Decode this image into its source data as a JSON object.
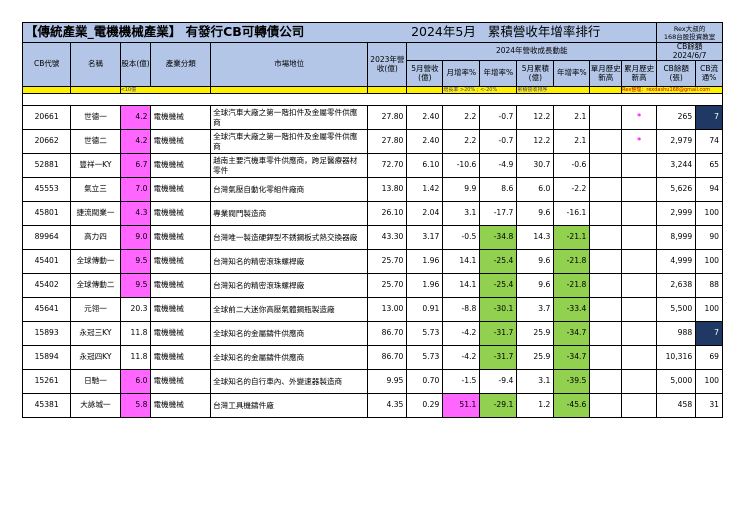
{
  "title": {
    "main": "【傳統產業_電機機械產業】 有發行CB可轉債公司",
    "month": "2024年5月",
    "rank": "累積營收年增率排行",
    "rex_line1": "Rex大叔的",
    "rex_line2": "168台股投資教室"
  },
  "headers": {
    "cb_code": "CB代號",
    "name": "名稱",
    "capital": "股本(億)",
    "industry": "產業分類",
    "position": "市場地位",
    "rev2023": "2023年營收(億)",
    "growth_group": "2024年營收成長動能",
    "may_rev": "5月營收(億)",
    "mom": "月增率%",
    "yoy": "年增率%",
    "may_cum": "5月累積(億)",
    "cum_yoy": "年增率%",
    "month_high": "單月歷史新高",
    "cum_high": "累月歷史新高",
    "cb_balance_group": "CB餘額",
    "cb_date": "2024/6/7",
    "cb_amount": "CB餘額(張)",
    "cb_ratio": "CB流通%"
  },
  "legend": {
    "capital_note": "<10億",
    "growth_note": "增長率 >20% ; <-20%",
    "cum_note": "累積營收排序",
    "rex_contact": "Rex整理：rexdashu168@gmail.com"
  },
  "colors": {
    "header_blue": "#b4c6e7",
    "yellow": "#fff200",
    "pink": "#ff66ff",
    "green": "#92d050",
    "navy": "#1f3864"
  },
  "rows": [
    {
      "code": "20661",
      "name": "世德一",
      "capital": "4.2",
      "capital_hl": true,
      "industry": "電機機械",
      "position": "全球汽車大廠之第一階扣件及金屬零件供應商",
      "rev2023": "27.80",
      "may_rev": "2.40",
      "mom": "2.2",
      "mom_hl": false,
      "yoy": "-0.7",
      "yoy_hl": false,
      "cum": "12.2",
      "cum_yoy": "2.1",
      "cum_yoy_hl": false,
      "month_high": "",
      "cum_high": "*",
      "cb_amount": "265",
      "cb_ratio": "7",
      "ratio_hl": true
    },
    {
      "code": "20662",
      "name": "世德二",
      "capital": "4.2",
      "capital_hl": true,
      "industry": "電機機械",
      "position": "全球汽車大廠之第一階扣件及金屬零件供應商",
      "rev2023": "27.80",
      "may_rev": "2.40",
      "mom": "2.2",
      "mom_hl": false,
      "yoy": "-0.7",
      "yoy_hl": false,
      "cum": "12.2",
      "cum_yoy": "2.1",
      "cum_yoy_hl": false,
      "month_high": "",
      "cum_high": "*",
      "cb_amount": "2,979",
      "cb_ratio": "74",
      "ratio_hl": false
    },
    {
      "code": "52881",
      "name": "豐祥一KY",
      "capital": "6.7",
      "capital_hl": true,
      "industry": "電機機械",
      "position": "越南主要汽機車零件供應商，跨足醫療器材零件",
      "rev2023": "72.70",
      "may_rev": "6.10",
      "mom": "-10.6",
      "mom_hl": false,
      "yoy": "-4.9",
      "yoy_hl": false,
      "cum": "30.7",
      "cum_yoy": "-0.6",
      "cum_yoy_hl": false,
      "month_high": "",
      "cum_high": "",
      "cb_amount": "3,244",
      "cb_ratio": "65",
      "ratio_hl": false
    },
    {
      "code": "45553",
      "name": "氣立三",
      "capital": "7.0",
      "capital_hl": true,
      "industry": "電機機械",
      "position": "台灣氣壓自動化零組件廠商",
      "rev2023": "13.80",
      "may_rev": "1.42",
      "mom": "9.9",
      "mom_hl": false,
      "yoy": "8.6",
      "yoy_hl": false,
      "cum": "6.0",
      "cum_yoy": "-2.2",
      "cum_yoy_hl": false,
      "month_high": "",
      "cum_high": "",
      "cb_amount": "5,626",
      "cb_ratio": "94",
      "ratio_hl": false
    },
    {
      "code": "45801",
      "name": "捷流閥業一",
      "capital": "4.3",
      "capital_hl": true,
      "industry": "電機機械",
      "position": "專業閥門製造商",
      "rev2023": "26.10",
      "may_rev": "2.04",
      "mom": "3.1",
      "mom_hl": false,
      "yoy": "-17.7",
      "yoy_hl": false,
      "cum": "9.6",
      "cum_yoy": "-16.1",
      "cum_yoy_hl": false,
      "month_high": "",
      "cum_high": "",
      "cb_amount": "2,999",
      "cb_ratio": "100",
      "ratio_hl": false
    },
    {
      "code": "89964",
      "name": "高力四",
      "capital": "9.0",
      "capital_hl": true,
      "industry": "電機機械",
      "position": "台灣唯一製造硬銲型不銹鋼板式熱交換器廠",
      "rev2023": "43.30",
      "may_rev": "3.17",
      "mom": "-0.5",
      "mom_hl": false,
      "yoy": "-34.8",
      "yoy_hl": true,
      "cum": "14.3",
      "cum_yoy": "-21.1",
      "cum_yoy_hl": true,
      "month_high": "",
      "cum_high": "",
      "cb_amount": "8,999",
      "cb_ratio": "90",
      "ratio_hl": false
    },
    {
      "code": "45401",
      "name": "全球傳動一",
      "capital": "9.5",
      "capital_hl": true,
      "industry": "電機機械",
      "position": "台灣知名的精密滾珠螺桿廠",
      "rev2023": "25.70",
      "may_rev": "1.96",
      "mom": "14.1",
      "mom_hl": false,
      "yoy": "-25.4",
      "yoy_hl": true,
      "cum": "9.6",
      "cum_yoy": "-21.8",
      "cum_yoy_hl": true,
      "month_high": "",
      "cum_high": "",
      "cb_amount": "4,999",
      "cb_ratio": "100",
      "ratio_hl": false
    },
    {
      "code": "45402",
      "name": "全球傳動二",
      "capital": "9.5",
      "capital_hl": true,
      "industry": "電機機械",
      "position": "台灣知名的精密滾珠螺桿廠",
      "rev2023": "25.70",
      "may_rev": "1.96",
      "mom": "14.1",
      "mom_hl": false,
      "yoy": "-25.4",
      "yoy_hl": true,
      "cum": "9.6",
      "cum_yoy": "-21.8",
      "cum_yoy_hl": true,
      "month_high": "",
      "cum_high": "",
      "cb_amount": "2,638",
      "cb_ratio": "88",
      "ratio_hl": false
    },
    {
      "code": "45641",
      "name": "元翎一",
      "capital": "20.3",
      "capital_hl": false,
      "industry": "電機機械",
      "position": "全球前二大迷你高壓氣體鋼瓶製造廠",
      "rev2023": "13.00",
      "may_rev": "0.91",
      "mom": "-8.8",
      "mom_hl": false,
      "yoy": "-30.1",
      "yoy_hl": true,
      "cum": "3.7",
      "cum_yoy": "-33.4",
      "cum_yoy_hl": true,
      "month_high": "",
      "cum_high": "",
      "cb_amount": "5,500",
      "cb_ratio": "100",
      "ratio_hl": false
    },
    {
      "code": "15893",
      "name": "永冠三KY",
      "capital": "11.8",
      "capital_hl": false,
      "industry": "電機機械",
      "position": "全球知名的金屬鑄件供應商",
      "rev2023": "86.70",
      "may_rev": "5.73",
      "mom": "-4.2",
      "mom_hl": false,
      "yoy": "-31.7",
      "yoy_hl": true,
      "cum": "25.9",
      "cum_yoy": "-34.7",
      "cum_yoy_hl": true,
      "month_high": "",
      "cum_high": "",
      "cb_amount": "988",
      "cb_ratio": "7",
      "ratio_hl": true
    },
    {
      "code": "15894",
      "name": "永冠四KY",
      "capital": "11.8",
      "capital_hl": false,
      "industry": "電機機械",
      "position": "全球知名的金屬鑄件供應商",
      "rev2023": "86.70",
      "may_rev": "5.73",
      "mom": "-4.2",
      "mom_hl": false,
      "yoy": "-31.7",
      "yoy_hl": true,
      "cum": "25.9",
      "cum_yoy": "-34.7",
      "cum_yoy_hl": true,
      "month_high": "",
      "cum_high": "",
      "cb_amount": "10,316",
      "cb_ratio": "69",
      "ratio_hl": false
    },
    {
      "code": "15261",
      "name": "日馳一",
      "capital": "6.0",
      "capital_hl": true,
      "industry": "電機機械",
      "position": "全球知名的自行車內、外變速器製造商",
      "rev2023": "9.95",
      "may_rev": "0.70",
      "mom": "-1.5",
      "mom_hl": false,
      "yoy": "-9.4",
      "yoy_hl": false,
      "cum": "3.1",
      "cum_yoy": "-39.5",
      "cum_yoy_hl": true,
      "month_high": "",
      "cum_high": "",
      "cb_amount": "5,000",
      "cb_ratio": "100",
      "ratio_hl": false
    },
    {
      "code": "45381",
      "name": "大詠城一",
      "capital": "5.8",
      "capital_hl": true,
      "industry": "電機機械",
      "position": "台灣工具機鑄件廠",
      "rev2023": "4.35",
      "may_rev": "0.29",
      "mom": "51.1",
      "mom_hl": true,
      "yoy": "-29.1",
      "yoy_hl": true,
      "cum": "1.2",
      "cum_yoy": "-45.6",
      "cum_yoy_hl": true,
      "month_high": "",
      "cum_high": "",
      "cb_amount": "458",
      "cb_ratio": "31",
      "ratio_hl": false
    }
  ]
}
